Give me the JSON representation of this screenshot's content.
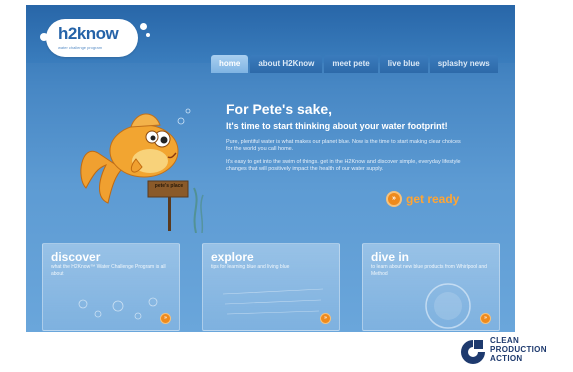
{
  "site": {
    "logo": {
      "text": "h2know",
      "tagline": "water challenge program"
    },
    "nav": {
      "tabs": [
        {
          "label": "home",
          "active": true
        },
        {
          "label": "about H2Know",
          "active": false
        },
        {
          "label": "meet pete",
          "active": false
        },
        {
          "label": "live blue",
          "active": false
        },
        {
          "label": "splashy news",
          "active": false
        }
      ]
    },
    "hero": {
      "title": "For Pete's sake,",
      "subtitle": "It's time to start thinking about your water footprint!",
      "paragraph1": "Pure, plentiful water is what makes our planet blue. Now is the time to start making clear choices for the world you call home.",
      "paragraph2": "It's easy to get into the swim of things. get in the H2Know and discover simple, everyday lifestyle changes that will positively impact the health of our water supply.",
      "sign_text": "pete's place",
      "cta_label": "get ready"
    },
    "cards": [
      {
        "title": "discover",
        "desc": "what the H2Know™ Water Challenge Program is all about"
      },
      {
        "title": "explore",
        "desc": "tips for learning blue and living blue"
      },
      {
        "title": "dive in",
        "desc": "to learn about new blue products from Whirlpool and Method"
      }
    ]
  },
  "branding": {
    "cpa_line1": "CLEAN",
    "cpa_line2": "PRODUCTION",
    "cpa_line3": "ACTION"
  },
  "colors": {
    "accent_orange": "#ef8a1c",
    "site_blue": "#4787c4",
    "cpa_navy": "#1e3a6e"
  }
}
